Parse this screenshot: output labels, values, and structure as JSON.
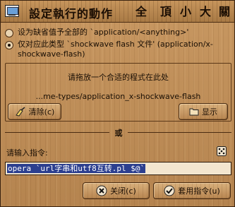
{
  "window": {
    "title": "設定執行的動作",
    "title_buttons": [
      "全",
      "頂",
      "小",
      "大",
      "關"
    ]
  },
  "options": [
    {
      "label": "设为缺省值予全部的 `application/<anything>'",
      "checked": false
    },
    {
      "label": "仅对应此类型 `shockwave flash 文件' (application/x-shockwave-flash)",
      "checked": true
    }
  ],
  "group": {
    "hint": "请拖放一个合适的程式在此处",
    "mime": "...me-types/application_x-shockwave-flash",
    "clear_label": "清除(c)",
    "show_label": "显示"
  },
  "separator": {
    "label": "或"
  },
  "command": {
    "label": "请输入指令:",
    "value": "opera `url字串和utf8互转.pl $@`"
  },
  "buttons": {
    "close_label": "关闭(c)",
    "apply_label": "套用指令(u)"
  },
  "colors": {
    "wood": "#b88a55",
    "selection": "#2c3f8f"
  }
}
